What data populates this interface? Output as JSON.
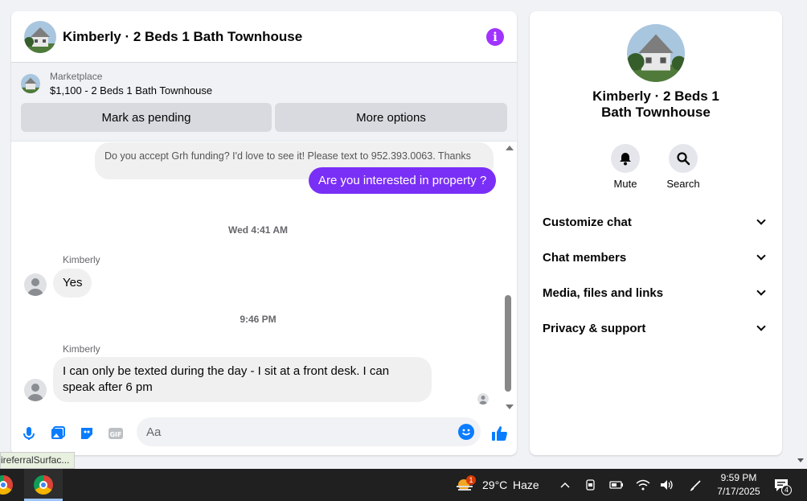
{
  "chat": {
    "title": "Kimberly · 2 Beds 1 Bath Townhouse",
    "marketplace_label": "Marketplace",
    "listing": "$1,100 - 2 Beds 1 Bath Townhouse",
    "mark_pending": "Mark as pending",
    "more_options": "More options",
    "msg_top": "Do you accept Grh funding?  I'd love to see it!  Please text to 952.393.0063.  Thanks",
    "msg_sent": "Are you interested in property ?",
    "ts1": "Wed 4:41 AM",
    "sender1": "Kimberly",
    "msg_yes": "Yes",
    "ts2": "9:46 PM",
    "sender2": "Kimberly",
    "msg_last": "I can only be texted during the day - I sit at a front desk. I can speak after 6 pm",
    "input_placeholder": "Aa"
  },
  "info": {
    "title": "Kimberly · 2 Beds 1 Bath Townhouse",
    "mute": "Mute",
    "search": "Search",
    "sections": [
      "Customize chat",
      "Chat members",
      "Media, files and links",
      "Privacy & support"
    ]
  },
  "status_tip": "ireferralSurfac...",
  "taskbar": {
    "weather_badge": "1",
    "weather": "29°C",
    "condition": "Haze",
    "time": "9:59 PM",
    "date": "7/17/2025",
    "notif_count": "4"
  },
  "colors": {
    "accent": "#0a7cff",
    "sent_bubble": "#7a2ff6",
    "info_icon": "#a033ff"
  }
}
